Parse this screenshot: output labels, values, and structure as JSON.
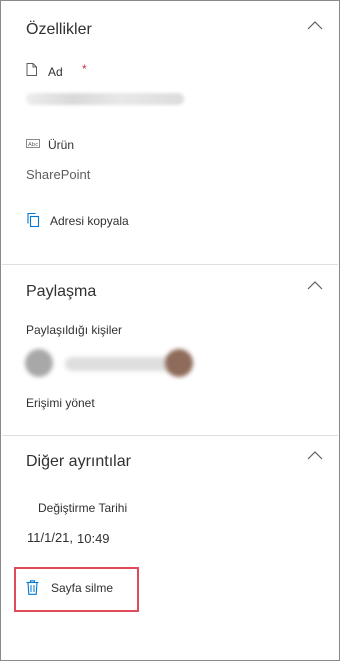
{
  "properties": {
    "title": "Özellikler",
    "name_label": "Ad",
    "required_mark": "*",
    "product_label": "Ürün",
    "product_value": "SharePoint",
    "copy_address": "Adresi kopyala"
  },
  "sharing": {
    "title": "Paylaşma",
    "shared_with": "Paylaşıldığı kişiler",
    "manage_access": "Erişimi yönet"
  },
  "details": {
    "title": "Diğer ayrıntılar",
    "modified_label": "Değiştirme Tarihi",
    "modified_date": "11/1/21,",
    "modified_time": "10:49"
  },
  "actions": {
    "delete_page": "Sayfa silme"
  },
  "colors": {
    "accent": "#0078d4",
    "required": "#c4314b",
    "highlight_border": "#e04a5a"
  },
  "icons": [
    "chevron-up-icon",
    "document-icon",
    "text-field-icon",
    "copy-icon",
    "trash-icon"
  ]
}
